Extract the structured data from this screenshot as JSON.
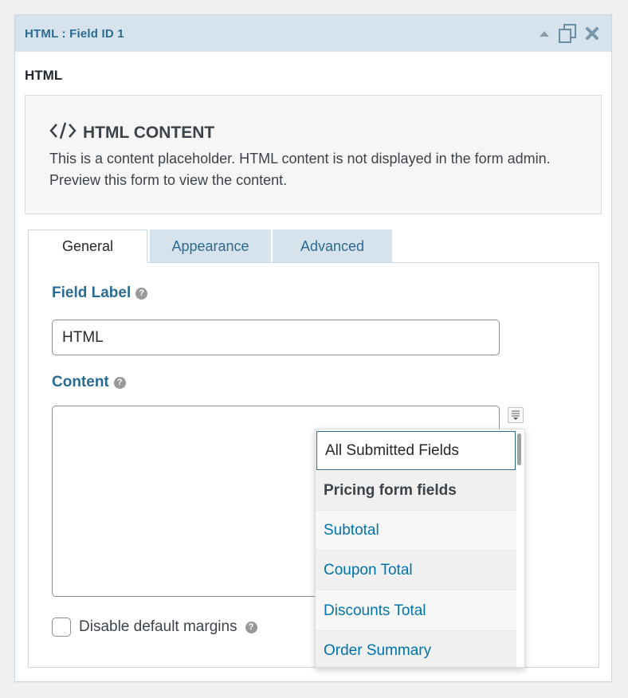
{
  "panel": {
    "title": "HTML : Field ID 1",
    "field_type": "HTML"
  },
  "placeholder": {
    "icon": "code-icon",
    "title": "HTML CONTENT",
    "text": "This is a content placeholder. HTML content is not displayed in the form admin. Preview this form to view the content."
  },
  "tabs": [
    {
      "label": "General",
      "active": true
    },
    {
      "label": "Appearance",
      "active": false
    },
    {
      "label": "Advanced",
      "active": false
    }
  ],
  "general": {
    "field_label": "Field Label",
    "field_label_value": "HTML",
    "content_label": "Content",
    "content_value": "",
    "disable_margins_label": "Disable default margins",
    "disable_margins_checked": false
  },
  "merge_tags": {
    "items": [
      {
        "label": "All Submitted Fields",
        "kind": "option",
        "highlighted": true
      },
      {
        "label": "Pricing form fields",
        "kind": "group"
      },
      {
        "label": "Subtotal",
        "kind": "option"
      },
      {
        "label": "Coupon Total",
        "kind": "option"
      },
      {
        "label": "Discounts Total",
        "kind": "option"
      },
      {
        "label": "Order Summary",
        "kind": "option"
      }
    ]
  },
  "colors": {
    "accent": "#2a6b93",
    "header_bg": "#d7e3ec",
    "link": "#0073aa"
  }
}
